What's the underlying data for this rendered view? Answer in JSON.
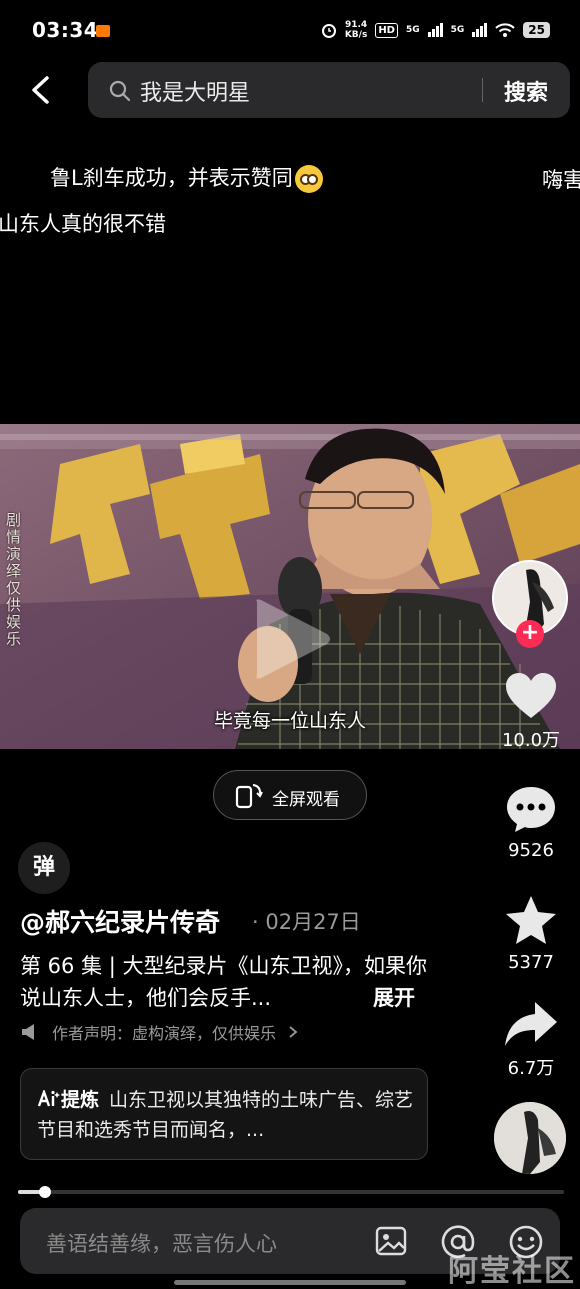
{
  "status_bar": {
    "time": "03:34",
    "net_speed_value": "91.4",
    "net_speed_unit": "KB/s",
    "hd": "HD",
    "network_1": "5G",
    "network_2": "5G",
    "battery": "25"
  },
  "search": {
    "query": "我是大明星",
    "submit_label": "搜索"
  },
  "danmaku": [
    "鲁L刹车成功，并表示赞同",
    "嗨害",
    "山东人真的很不错"
  ],
  "video": {
    "watermark": "剧情演绎仅供娱乐",
    "subtitle": "毕竟每一位山东人",
    "fullscreen_label": "全屏观看"
  },
  "danmaku_toggle": "弹",
  "post": {
    "author": "@郝六纪录片传奇",
    "date": "· 02月27日",
    "description": "第 66 集 | 大型纪录片《山东卫视》，如果你说山东人士，他们会反手...",
    "expand_label": "展开",
    "disclaimer": "作者声明：虚构演绎，仅供娱乐"
  },
  "ai_summary": {
    "tag": "提炼",
    "text": "山东卫视以其独特的土味广告、综艺节目和选秀节目而闻名，..."
  },
  "actions": {
    "likes": "10.0万",
    "comments": "9526",
    "favorites": "5377",
    "shares": "6.7万"
  },
  "playback": {
    "progress": 0.05
  },
  "comment": {
    "placeholder": "善语结善缘，恶言伤人心"
  },
  "watermark": {
    "site": "阿莹社区"
  },
  "colors": {
    "accent": "#fe2c55",
    "background": "#000000",
    "panel": "#2a2a2c"
  }
}
